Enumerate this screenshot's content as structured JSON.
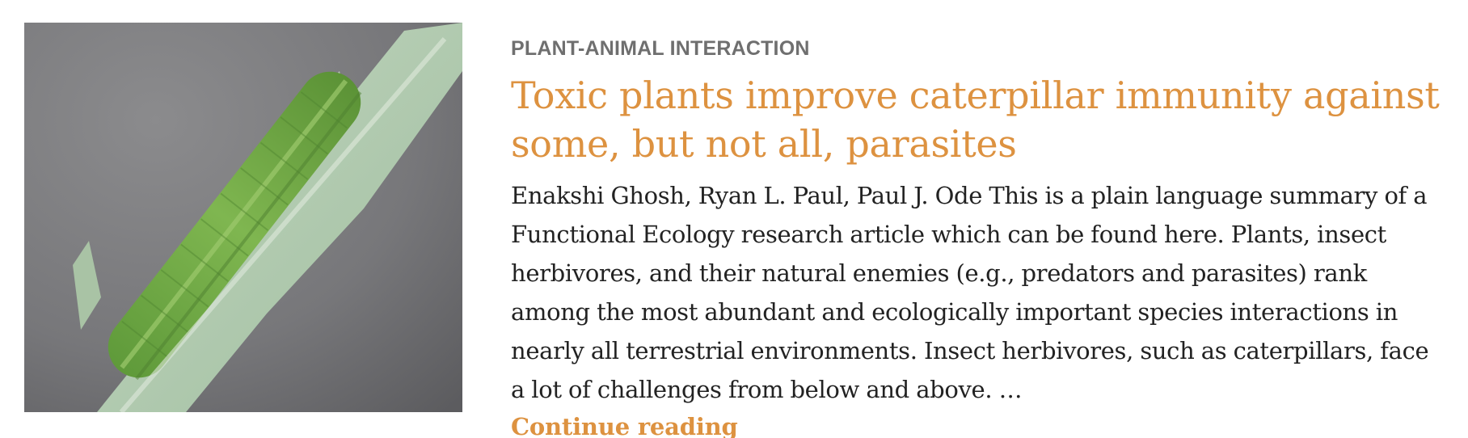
{
  "post": {
    "category": "PLANT-ANIMAL INTERACTION",
    "title": "Toxic plants improve caterpillar immunity against some, but not all, parasites",
    "excerpt": "Enakshi Ghosh, Ryan L. Paul, Paul J. Ode This is a plain language summary of a Functional Ecology research article which can be found here. Plants, insect herbivores, and their natural enemies (e.g., predators and parasites) rank among the most abundant and ecologically important species interactions in nearly all terrestrial environments. Insect herbivores, such as caterpillars, face a lot of challenges from below and above. …",
    "continue_label": "Continue reading"
  },
  "colors": {
    "accent": "#dd9240",
    "category": "#6f6f6f",
    "body_text": "#222222"
  }
}
